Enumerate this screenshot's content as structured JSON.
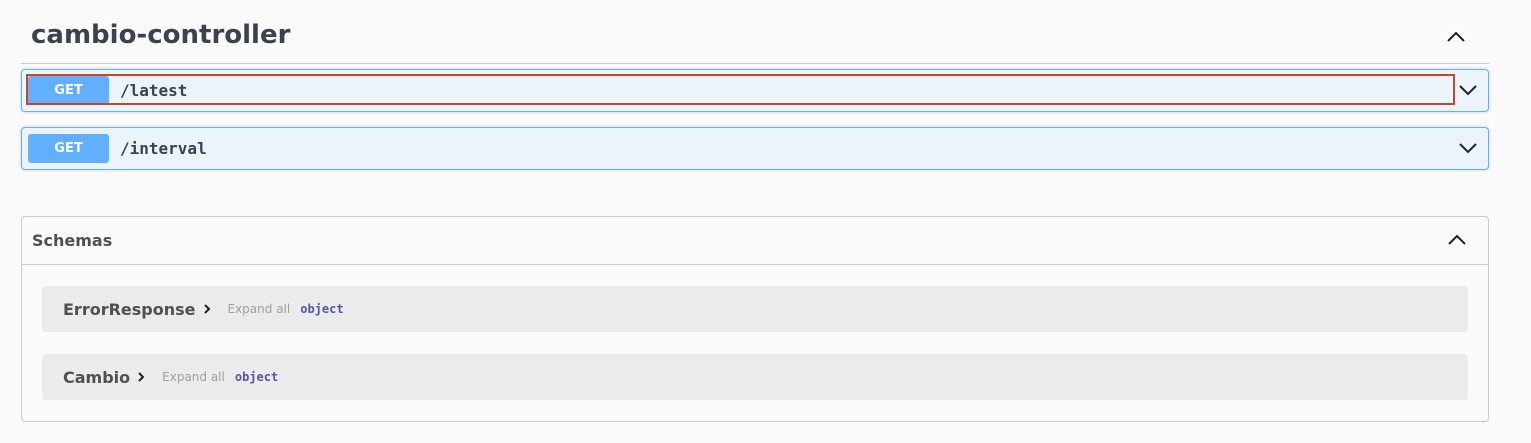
{
  "tag": {
    "title": "cambio-controller"
  },
  "operations": [
    {
      "method": "GET",
      "path": "/latest",
      "focused": true
    },
    {
      "method": "GET",
      "path": "/interval",
      "focused": false
    }
  ],
  "schemas": {
    "title": "Schemas",
    "models": [
      {
        "name": "ErrorResponse",
        "expand_label": "Expand all",
        "type": "object"
      },
      {
        "name": "Cambio",
        "expand_label": "Expand all",
        "type": "object"
      }
    ]
  },
  "colors": {
    "get_accent": "#61affe",
    "get_background": "#ebf3fb",
    "focus_outline": "#c4472c",
    "text": "#3b4151",
    "model_type": "#5555aa"
  },
  "icons": {
    "tag_toggle": "chevron-up-icon",
    "op_toggle": "chevron-down-icon",
    "schemas_toggle": "chevron-up-icon",
    "model_expand": "chevron-right-icon"
  }
}
